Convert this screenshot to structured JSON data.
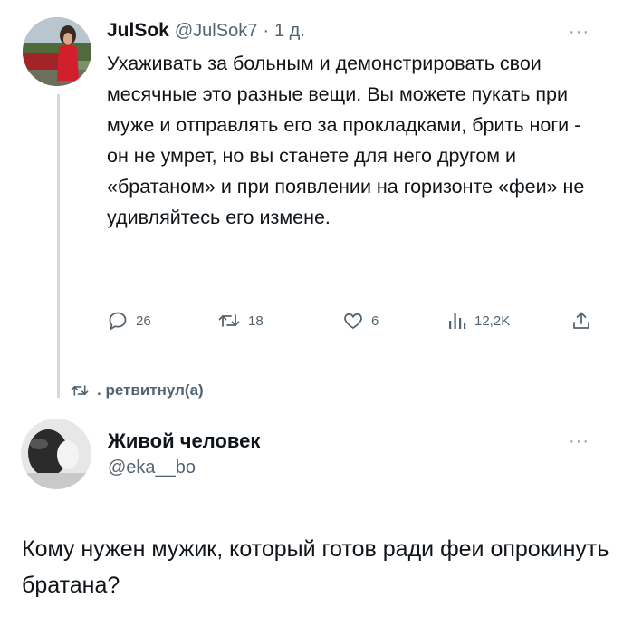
{
  "tweet": {
    "display_name": "JulSok",
    "handle": "@JulSok7",
    "separator": "·",
    "time": "1 д.",
    "more": "···",
    "text": "Ухаживать за больным и демонстрировать свои месячные это разные вещи. Вы можете пукать при муже и отправлять его за прокладками, брить ноги - он не умрет, но вы станете для него другом и «братаном» и при появлении на горизонте «феи» не удивляйтесь его измене.",
    "actions": {
      "replies": "26",
      "retweets": "18",
      "likes": "6",
      "views": "12,2K"
    },
    "retweet_note": ". ретвитнул(а)",
    "icons": {
      "reply": "reply-icon",
      "retweet": "retweet-icon",
      "like": "heart-icon",
      "views": "views-icon",
      "share": "share-icon"
    }
  },
  "reply": {
    "display_name": "Живой человек",
    "handle": "@eka__bo",
    "more": "···",
    "text": "Кому нужен мужик, который готов ради феи опрокинуть братана?"
  },
  "colors": {
    "text": "#0f1419",
    "secondary": "#536471",
    "thread_line": "#cfd9de"
  }
}
